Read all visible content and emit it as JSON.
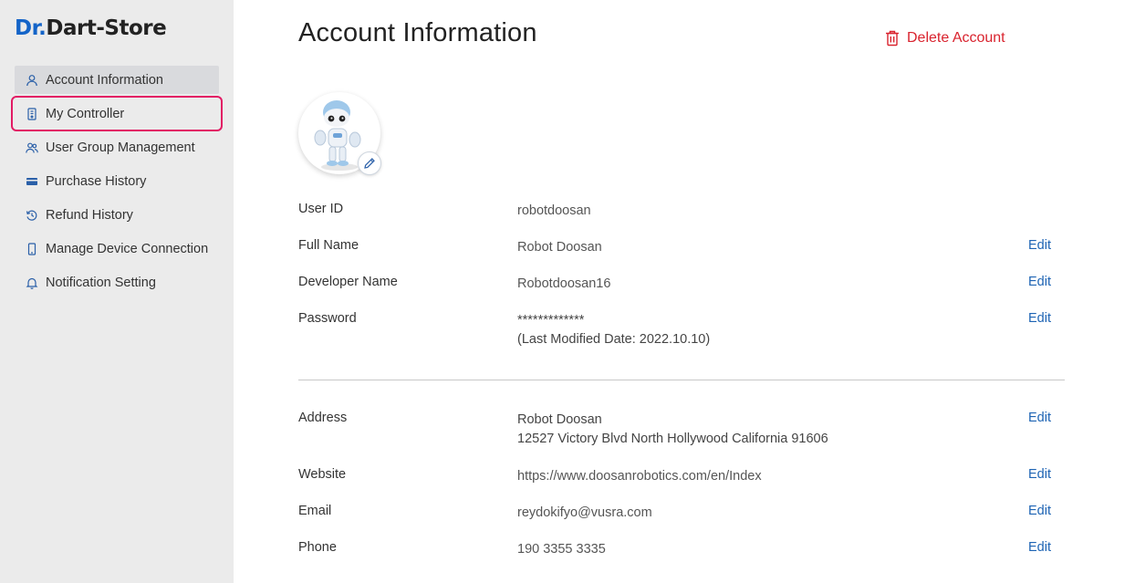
{
  "logo": {
    "dr": "Dr.",
    "dart": "Dart",
    "store": "-Store"
  },
  "sidebar": {
    "items": [
      {
        "label": "Account Information",
        "icon": "user-icon"
      },
      {
        "label": "My Controller",
        "icon": "controller-icon"
      },
      {
        "label": "User Group Management",
        "icon": "user-group-icon"
      },
      {
        "label": "Purchase History",
        "icon": "card-icon"
      },
      {
        "label": "Refund History",
        "icon": "refund-icon"
      },
      {
        "label": "Manage Device Connection",
        "icon": "device-icon"
      },
      {
        "label": "Notification Setting",
        "icon": "bell-icon"
      }
    ]
  },
  "main": {
    "title": "Account Information",
    "delete_label": "Delete Account",
    "edit_label": "Edit",
    "fields": {
      "user_id": {
        "label": "User ID",
        "value": "robotdoosan"
      },
      "full_name": {
        "label": "Full Name",
        "value": "Robot Doosan"
      },
      "developer_name": {
        "label": "Developer Name",
        "value": "Robotdoosan16"
      },
      "password": {
        "label": "Password",
        "value": "*************",
        "sub": "(Last Modified Date: 2022.10.10)"
      },
      "address": {
        "label": "Address",
        "value": "Robot Doosan",
        "sub": "12527 Victory Blvd North Hollywood California 91606"
      },
      "website": {
        "label": "Website",
        "value": "https://www.doosanrobotics.com/en/Index"
      },
      "email": {
        "label": "Email",
        "value": "reydokifyo@vusra.com"
      },
      "phone": {
        "label": "Phone",
        "value": "190 3355 3335"
      }
    }
  },
  "colors": {
    "accent": "#1e64b4",
    "danger": "#d9232e",
    "highlight": "#e21b64",
    "sidebar_bg": "#ebebeb"
  }
}
